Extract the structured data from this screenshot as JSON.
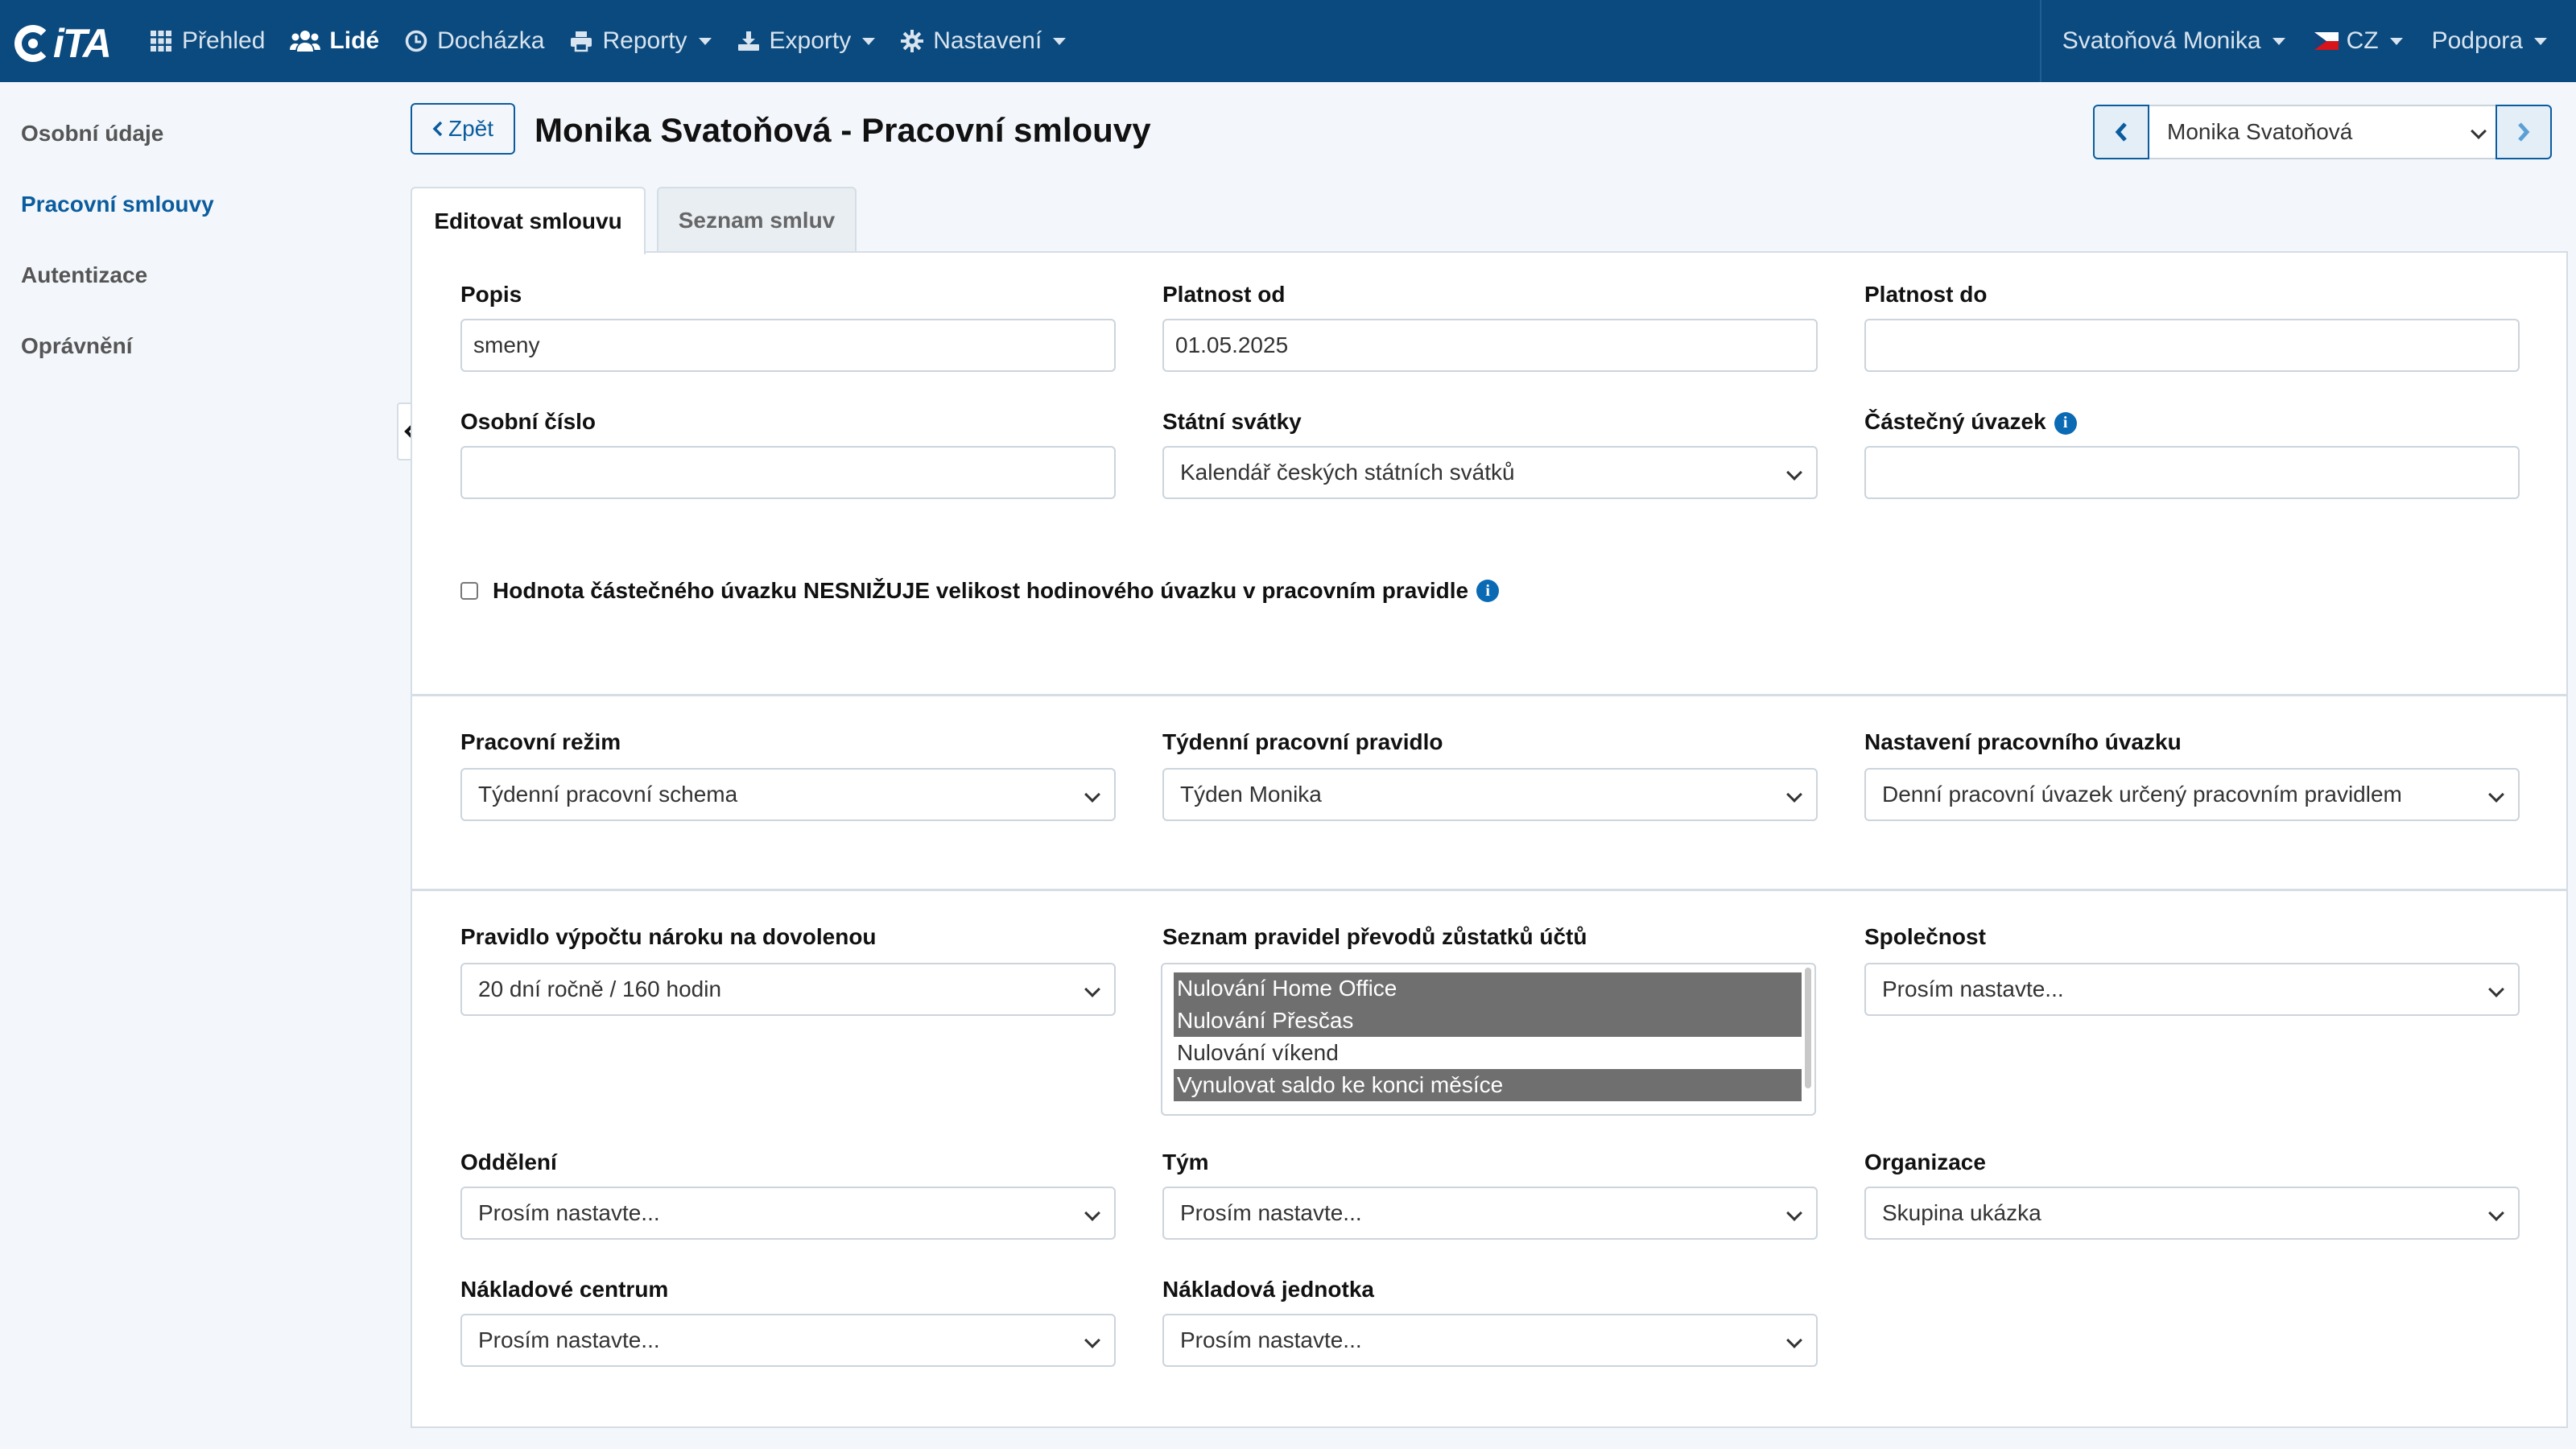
{
  "logo": {
    "text": "iTA"
  },
  "nav": {
    "items": [
      {
        "label": "Přehled",
        "icon": "grid-icon"
      },
      {
        "label": "Lidé",
        "icon": "users-icon",
        "active": true
      },
      {
        "label": "Docházka",
        "icon": "clock-icon"
      },
      {
        "label": "Reporty",
        "icon": "print-icon"
      },
      {
        "label": "Exporty",
        "icon": "export-icon"
      },
      {
        "label": "Nastavení",
        "icon": "gear-icon"
      }
    ],
    "user": "Svatoňová Monika",
    "language": "CZ",
    "support": "Podpora"
  },
  "sidebar": {
    "items": [
      {
        "label": "Osobní údaje"
      },
      {
        "label": "Pracovní smlouvy",
        "active": true
      },
      {
        "label": "Autentizace"
      },
      {
        "label": "Oprávnění"
      }
    ]
  },
  "header": {
    "back_label": "Zpět",
    "title": "Monika Svatoňová - Pracovní smlouvy",
    "person_select": "Monika Svatoňová"
  },
  "tabs": [
    {
      "label": "Editovat smlouvu",
      "active": true
    },
    {
      "label": "Seznam smluv"
    }
  ],
  "form": {
    "popis": {
      "label": "Popis",
      "value": "smeny"
    },
    "platnost_od": {
      "label": "Platnost od",
      "value": "01.05.2025"
    },
    "platnost_do": {
      "label": "Platnost do",
      "value": ""
    },
    "osobni_cislo": {
      "label": "Osobní číslo",
      "value": ""
    },
    "statni_svatky": {
      "label": "Státní svátky",
      "value": "Kalendář českých státních svátků"
    },
    "castecny_uvazek": {
      "label": "Částečný úvazek",
      "value": ""
    },
    "checkbox_label": "Hodnota částečného úvazku NESNIŽUJE velikost hodinového úvazku v pracovním pravidle",
    "pracovni_rezim": {
      "label": "Pracovní režim",
      "value": "Týdenní pracovní schema"
    },
    "tydenni_pravidlo": {
      "label": "Týdenní pracovní pravidlo",
      "value": "Týden Monika"
    },
    "nastaveni_uvazku": {
      "label": "Nastavení pracovního úvazku",
      "value": "Denní pracovní úvazek určený pracovním pravidlem"
    },
    "dovolena": {
      "label": "Pravidlo výpočtu nároku na dovolenou",
      "value": "20 dní ročně / 160 hodin"
    },
    "prevody": {
      "label": "Seznam pravidel převodů zůstatků účtů",
      "options": [
        {
          "label": "Nulování Home Office",
          "selected": true
        },
        {
          "label": "Nulování Přesčas",
          "selected": true
        },
        {
          "label": "Nulování víkend",
          "selected": false
        },
        {
          "label": "Vynulovat saldo ke konci měsíce",
          "selected": true
        }
      ]
    },
    "spolecnost": {
      "label": "Společnost",
      "value": "Prosím nastavte..."
    },
    "oddeleni": {
      "label": "Oddělení",
      "value": "Prosím nastavte..."
    },
    "tym": {
      "label": "Tým",
      "value": "Prosím nastavte..."
    },
    "organizace": {
      "label": "Organizace",
      "value": "Skupina ukázka"
    },
    "nakladove_centrum": {
      "label": "Nákladové centrum",
      "value": "Prosím nastavte..."
    },
    "nakladova_jednotka": {
      "label": "Nákladová jednotka",
      "value": "Prosím nastavte..."
    }
  },
  "colors": {
    "navbar": "#0b4a7e",
    "accent": "#0b5c9e",
    "selected_option": "#6f6f6f"
  }
}
